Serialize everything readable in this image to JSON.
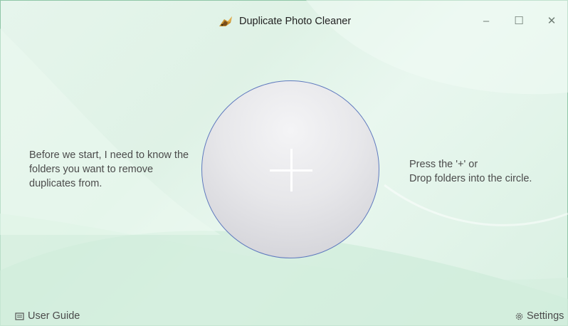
{
  "app": {
    "title": "Duplicate Photo Cleaner",
    "icon": "bird-feather-logo-icon"
  },
  "window_controls": {
    "minimize": "–",
    "maximize": "☐",
    "close": "✕"
  },
  "main": {
    "left_instruction": "Before we start, I need to know the folders you want to remove duplicates from.",
    "right_instruction_lines": [
      "Press the '+' or",
      "Drop folders into the circle."
    ],
    "drop_zone_icon": "plus-icon"
  },
  "footer": {
    "user_guide_label": "User Guide",
    "user_guide_icon": "book-icon",
    "settings_label": "Settings",
    "settings_icon": "gear-icon"
  },
  "colors": {
    "background": "#e3f4ea",
    "circle_border": "#5f79be",
    "text": "#4b4b4b"
  }
}
